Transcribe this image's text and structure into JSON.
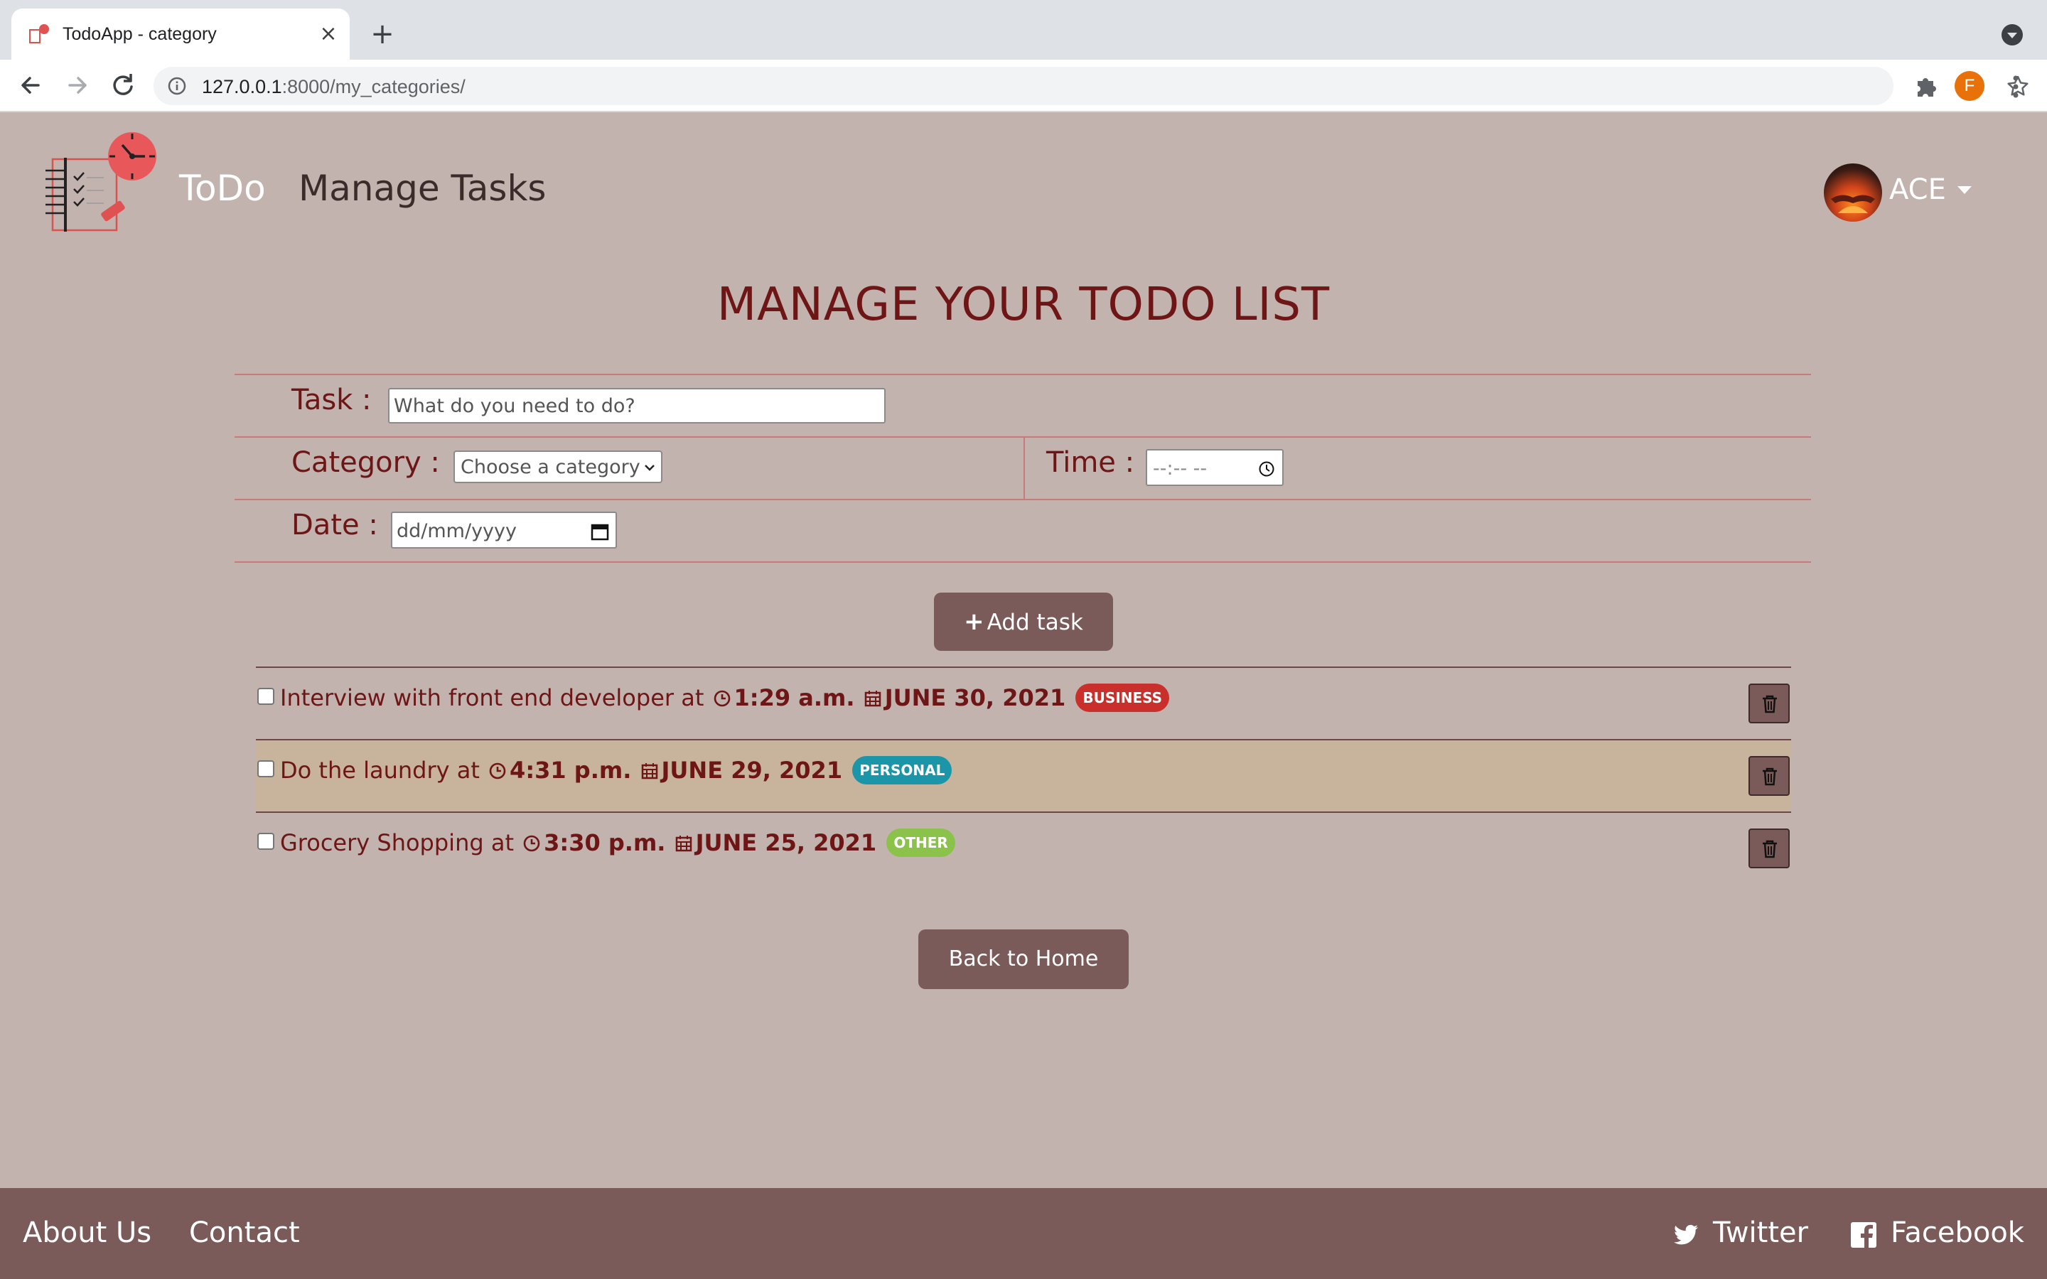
{
  "browser": {
    "tab_title": "TodoApp - category",
    "new_tab": "+",
    "close_tab": "×",
    "url_host": "127.0.0.1",
    "url_rest": ":8000/my_categories/",
    "profile_initial": "F"
  },
  "navbar": {
    "brand": "ToDo",
    "link": "Manage Tasks",
    "user": "ACE"
  },
  "page": {
    "title": "MANAGE YOUR TODO LIST"
  },
  "form": {
    "task_label": "Task :",
    "task_placeholder": "What do you need to do?",
    "category_label": "Category :",
    "category_selected": "Choose a category",
    "time_label": "Time :",
    "time_value": "--:-- --",
    "date_label": "Date :",
    "date_value": "dd/mm/yyyy",
    "add_button": "Add task"
  },
  "tasks": [
    {
      "text": "Interview with front end developer at",
      "time": "1:29 a.m.",
      "date": "JUNE 30, 2021",
      "category": "BUSINESS",
      "badge_color": "#c9302c"
    },
    {
      "text": "Do the laundry at",
      "time": "4:31 p.m.",
      "date": "JUNE 29, 2021",
      "category": "PERSONAL",
      "badge_color": "#1b96a8"
    },
    {
      "text": "Grocery Shopping at",
      "time": "3:30 p.m.",
      "date": "JUNE 25, 2021",
      "category": "OTHER",
      "badge_color": "#8bc34a"
    }
  ],
  "home_button": "Back to Home",
  "footer": {
    "about": "About Us",
    "contact": "Contact",
    "twitter": "Twitter",
    "facebook": "Facebook"
  },
  "colors": {
    "page_bg": "#c3b3ae",
    "accent": "#7b5a5a",
    "title": "#6e1515",
    "highlight_row": "#c8b49c"
  },
  "icons": [
    "clock-icon",
    "calendar-icon",
    "trash-icon",
    "plus-icon",
    "twitter-icon",
    "facebook-icon"
  ]
}
